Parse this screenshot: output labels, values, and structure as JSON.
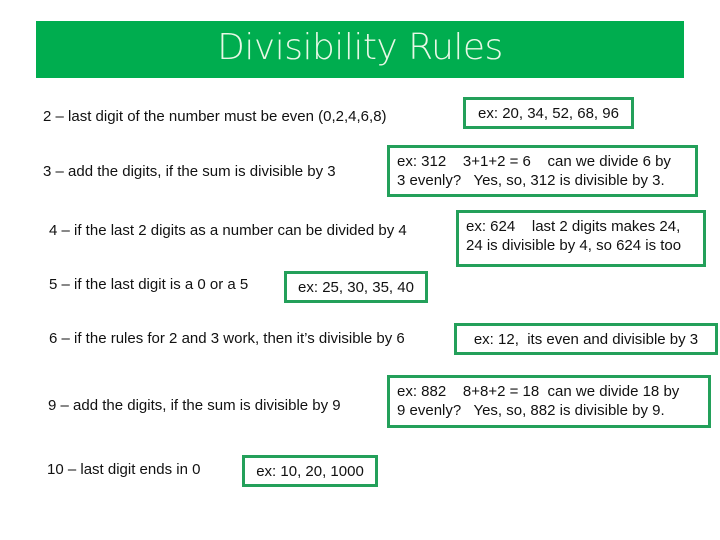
{
  "header": {
    "title": "Divisibility Rules",
    "background_color": "#00ad4f",
    "text_color": "#e8f8e6"
  },
  "box_border_color": "#23a05a",
  "rules": [
    {
      "divisor": "2",
      "rule": "2 – last digit of the number must be even (0,2,4,6,8)",
      "example_lines": [
        "ex: 20, 34, 52, 68, 96"
      ]
    },
    {
      "divisor": "3",
      "rule": "3 – add the digits, if the sum is divisible by 3",
      "example_lines": [
        "ex: 312    3+1+2 = 6    can we divide 6 by",
        "3 evenly?   Yes, so, 312 is divisible by 3."
      ]
    },
    {
      "divisor": "4",
      "rule": "4 – if the last 2 digits as a number can be divided by 4",
      "example_lines": [
        "ex: 624    last 2 digits makes 24,",
        "24 is divisible by 4, so 624 is too"
      ]
    },
    {
      "divisor": "5",
      "rule": "5 – if the last digit is a 0 or a 5",
      "example_lines": [
        "ex: 25, 30, 35, 40"
      ]
    },
    {
      "divisor": "6",
      "rule": "6 – if the rules for 2 and 3 work, then it’s divisible by 6",
      "example_lines": [
        "ex: 12,  its even and divisible by 3"
      ]
    },
    {
      "divisor": "9",
      "rule": "9 – add the digits, if the sum is divisible by 9",
      "example_lines": [
        "ex: 882    8+8+2 = 18  can we divide 18 by",
        "9 evenly?   Yes, so, 882 is divisible by 9."
      ]
    },
    {
      "divisor": "10",
      "rule": "10 – last digit ends in 0",
      "example_lines": [
        "ex: 10, 20, 1000"
      ]
    }
  ]
}
